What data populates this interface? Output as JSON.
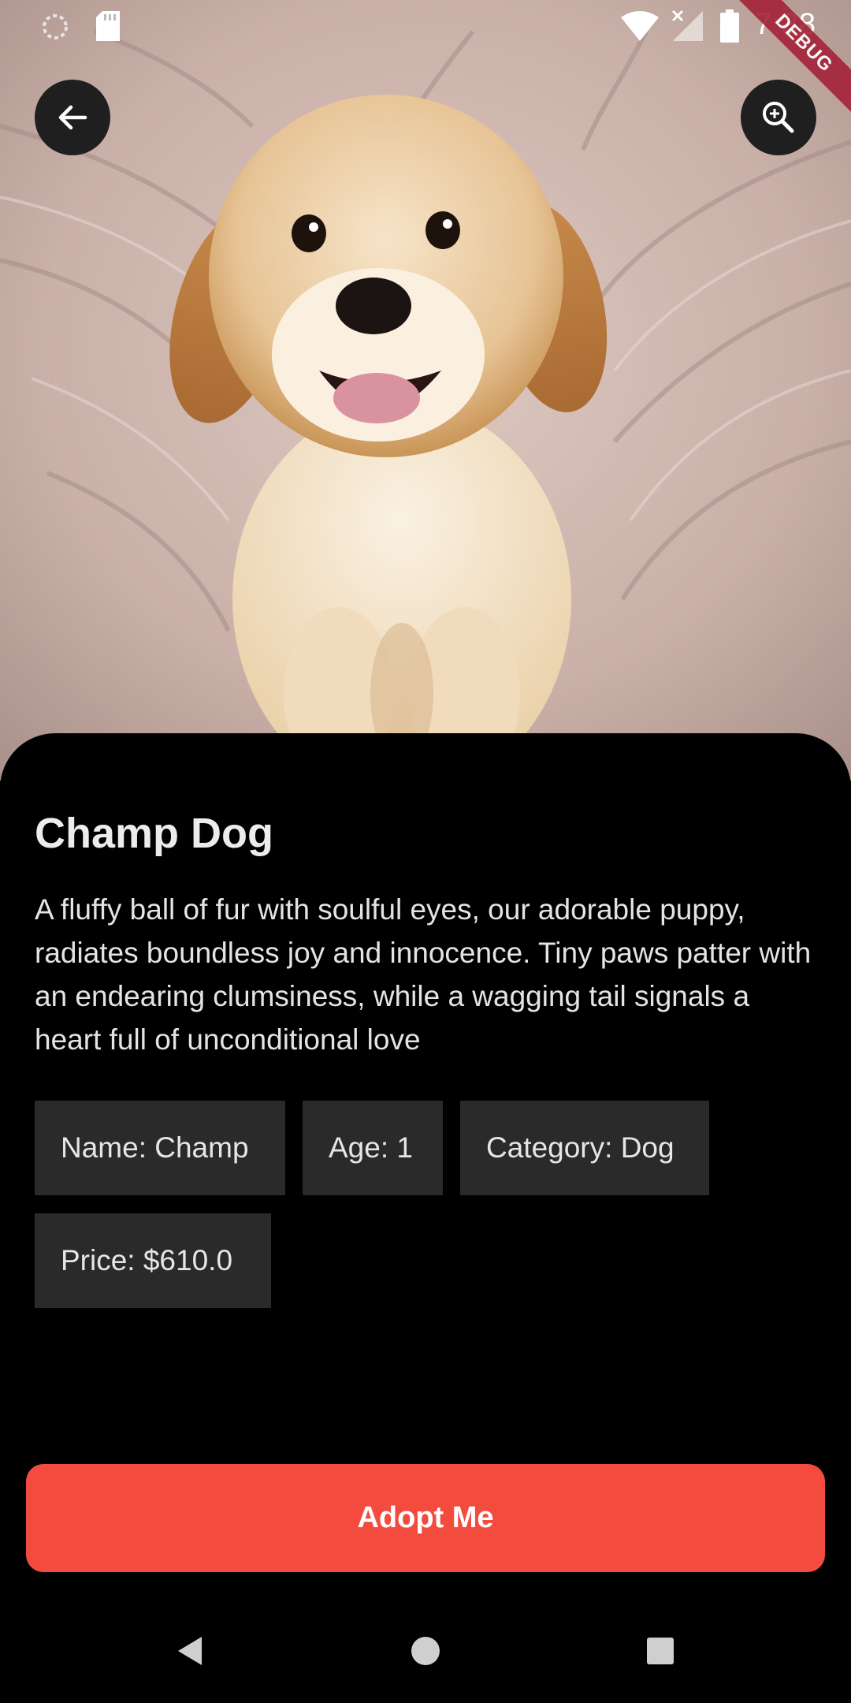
{
  "status_bar": {
    "time": "7:38",
    "icons": [
      "loading-spinner-icon",
      "sd-card-icon",
      "wifi-icon",
      "signal-no-data-icon",
      "battery-icon"
    ]
  },
  "debug_banner": "DEBUG",
  "hero": {
    "description_image": "puppy-photo",
    "back_icon": "arrow-back-icon",
    "zoom_icon": "zoom-in-icon"
  },
  "pet": {
    "title": "Champ Dog",
    "description": "A fluffy ball of fur with soulful eyes, our adorable puppy, radiates boundless joy and innocence. Tiny paws patter with an endearing clumsiness, while a wagging tail signals a heart full of unconditional love",
    "chips": {
      "name": "Name: Champ",
      "age": "Age: 1",
      "category": "Category: Dog",
      "price": "Price: $610.0"
    }
  },
  "actions": {
    "adopt_label": "Adopt Me"
  },
  "nav_bar": {
    "icons": [
      "nav-back-icon",
      "nav-home-icon",
      "nav-recents-icon"
    ]
  },
  "colors": {
    "accent": "#f44b3f",
    "chip_bg": "#2a2a2a",
    "sheet_bg": "#000000",
    "debug_ribbon": "#a5253b"
  }
}
